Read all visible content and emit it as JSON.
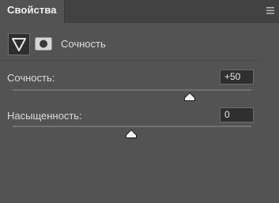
{
  "panel": {
    "tab_title": "Свойства",
    "menu_icon": "panel-menu-icon"
  },
  "adjustment": {
    "type_icon": "vibrance-triangle-icon",
    "mask_icon": "layer-mask-icon",
    "type_label": "Сочность"
  },
  "sliders": [
    {
      "label": "Сочность:",
      "value": "+50",
      "min": -100,
      "max": 100,
      "position": 50
    },
    {
      "label": "Насыщенность:",
      "value": "0",
      "min": -100,
      "max": 100,
      "position": 0
    }
  ]
}
